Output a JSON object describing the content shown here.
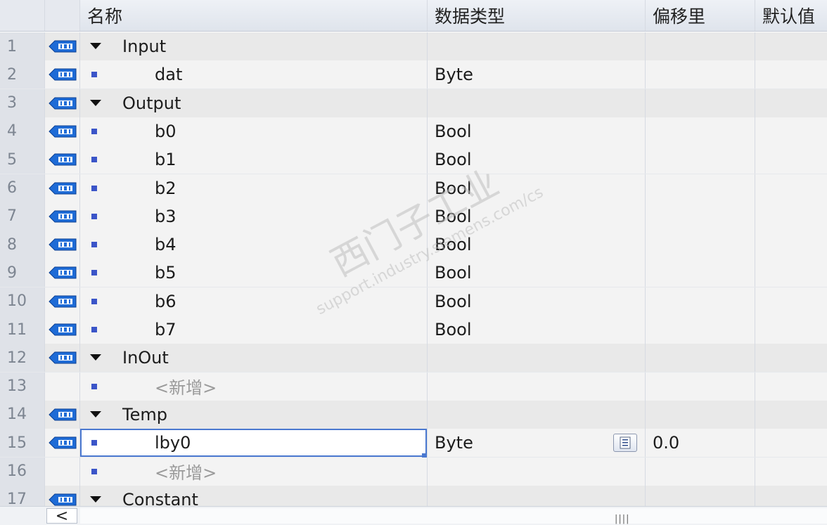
{
  "header": {
    "name": "名称",
    "datatype": "数据类型",
    "offset": "偏移里",
    "default": "默认值"
  },
  "rows": [
    {
      "num": "1",
      "kind": "group",
      "name": "Input",
      "type": "",
      "offset": "",
      "tag": true
    },
    {
      "num": "2",
      "kind": "item",
      "name": "dat",
      "type": "Byte",
      "offset": "",
      "tag": true
    },
    {
      "num": "3",
      "kind": "group",
      "name": "Output",
      "type": "",
      "offset": "",
      "tag": true
    },
    {
      "num": "4",
      "kind": "item",
      "name": "b0",
      "type": "Bool",
      "offset": "",
      "tag": true
    },
    {
      "num": "5",
      "kind": "item",
      "name": "b1",
      "type": "Bool",
      "offset": "",
      "tag": true
    },
    {
      "num": "6",
      "kind": "item",
      "name": "b2",
      "type": "Bool",
      "offset": "",
      "tag": true
    },
    {
      "num": "7",
      "kind": "item",
      "name": "b3",
      "type": "Bool",
      "offset": "",
      "tag": true
    },
    {
      "num": "8",
      "kind": "item",
      "name": "b4",
      "type": "Bool",
      "offset": "",
      "tag": true
    },
    {
      "num": "9",
      "kind": "item",
      "name": "b5",
      "type": "Bool",
      "offset": "",
      "tag": true
    },
    {
      "num": "10",
      "kind": "item",
      "name": "b6",
      "type": "Bool",
      "offset": "",
      "tag": true
    },
    {
      "num": "11",
      "kind": "item",
      "name": "b7",
      "type": "Bool",
      "offset": "",
      "tag": true
    },
    {
      "num": "12",
      "kind": "group",
      "name": "InOut",
      "type": "",
      "offset": "",
      "tag": true
    },
    {
      "num": "13",
      "kind": "add",
      "name": "<新增>",
      "type": "",
      "offset": "",
      "tag": false
    },
    {
      "num": "14",
      "kind": "group",
      "name": "Temp",
      "type": "",
      "offset": "",
      "tag": true
    },
    {
      "num": "15",
      "kind": "item",
      "name": "lby0",
      "type": "Byte",
      "offset": "0.0",
      "tag": true,
      "selected": true
    },
    {
      "num": "16",
      "kind": "add",
      "name": "<新增>",
      "type": "",
      "offset": "",
      "tag": false
    },
    {
      "num": "17",
      "kind": "group",
      "name": "Constant",
      "type": "",
      "offset": "",
      "tag": true
    }
  ],
  "scrollbar": {
    "left_arrow": "<",
    "grip": "||||"
  },
  "watermark": {
    "line1": "西门子工业",
    "line2": "support.industry.siemens.com/cs"
  },
  "colors": {
    "accent": "#4a78d0",
    "tag_icon": "#1e6bd6",
    "member_square": "#3b55c8"
  },
  "icons": {
    "interface_tag": "interface-tag-icon",
    "expand": "expand-triangle-icon",
    "member": "member-square-icon",
    "list": "datatype-list-icon"
  }
}
